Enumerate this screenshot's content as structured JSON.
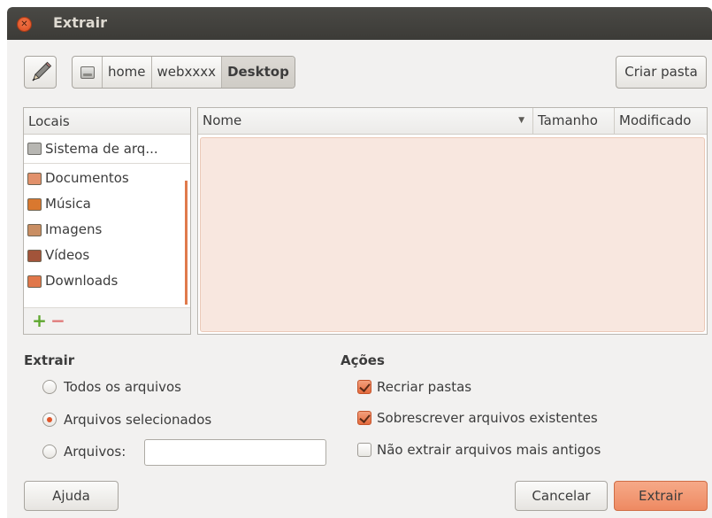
{
  "window": {
    "title": "Extrair"
  },
  "toolbar": {
    "breadcrumbs": [
      "home",
      "webxxxx",
      "Desktop"
    ],
    "create_folder_label": "Criar pasta"
  },
  "places": {
    "header": "Locais",
    "items": [
      {
        "label": "Sistema de arq...",
        "icon": "drive-icon",
        "color": "#b7b6b2"
      },
      {
        "label": "Documentos",
        "icon": "documents-folder-icon",
        "color": "#e2916b"
      },
      {
        "label": "Música",
        "icon": "music-folder-icon",
        "color": "#d9782f"
      },
      {
        "label": "Imagens",
        "icon": "pictures-folder-icon",
        "color": "#c98e63"
      },
      {
        "label": "Vídeos",
        "icon": "videos-folder-icon",
        "color": "#a2543a"
      },
      {
        "label": "Downloads",
        "icon": "downloads-folder-icon",
        "color": "#e0774a"
      }
    ]
  },
  "files": {
    "columns": {
      "name": "Nome",
      "size": "Tamanho",
      "modified": "Modificado"
    }
  },
  "extract": {
    "title": "Extrair",
    "all_files": "Todos os arquivos",
    "selected_files": "Arquivos selecionados",
    "files_label": "Arquivos:",
    "files_value": "",
    "selected_option": "selected_files"
  },
  "actions": {
    "title": "Ações",
    "recreate_folders": {
      "label": "Recriar pastas",
      "checked": true
    },
    "overwrite": {
      "label": "Sobrescrever arquivos existentes",
      "checked": true
    },
    "no_older": {
      "label": "Não extrair arquivos mais antigos",
      "checked": false
    }
  },
  "buttons": {
    "help": "Ajuda",
    "cancel": "Cancelar",
    "extract": "Extrair"
  },
  "colors": {
    "accent": "#e0562a",
    "titlebar": "#3c3b37",
    "selection": "#f8e7df"
  }
}
